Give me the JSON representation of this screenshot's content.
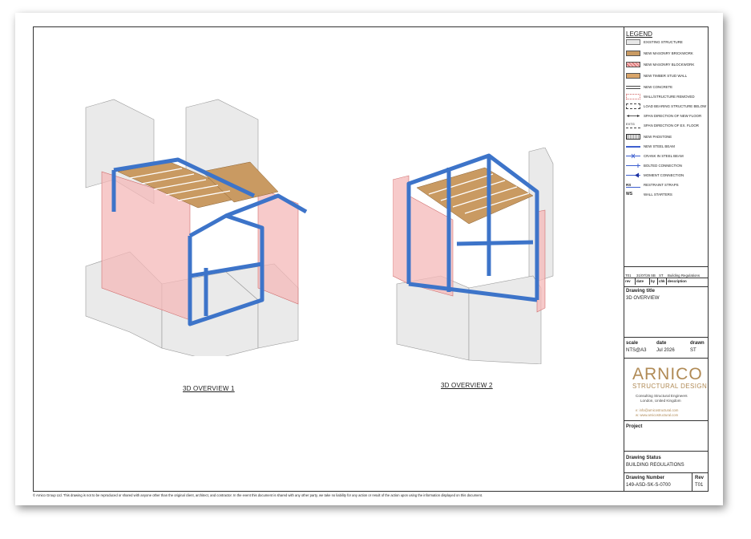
{
  "views": [
    {
      "label": "3D OVERVIEW 1"
    },
    {
      "label": "3D OVERVIEW 2"
    }
  ],
  "legend": {
    "title": "LEGEND",
    "items": [
      {
        "label": "EXISTING STRUCTURE"
      },
      {
        "label": "NEW MASONRY BRICKWORK"
      },
      {
        "label": "NEW MASONRY BLOCKWORK"
      },
      {
        "label": "NEW TIMBER STUD WALL"
      },
      {
        "label": "NEW CONCRETE"
      },
      {
        "label": "WALL/STRUCTURE REMOVED"
      },
      {
        "label": "LOAD BEARING STRUCTURE BELOW"
      },
      {
        "label": "SPAN DIRECTION OF NEW FLOOR"
      },
      {
        "label": "SPAN DIRECTION OF EX. FLOOR",
        "symbol_text": "EXTG"
      },
      {
        "label": "NEW PADSTONE"
      },
      {
        "label": "NEW STEEL BEAM"
      },
      {
        "label": "CRANK IN STEEL BEAM"
      },
      {
        "label": "BOLTED CONNECTION"
      },
      {
        "label": "MOMENT CONNECTION"
      },
      {
        "label": "RESTRAINT STRAPS",
        "symbol_text": "RS"
      },
      {
        "label": "WALL STARTERS",
        "symbol_text": "WS"
      }
    ]
  },
  "revision": {
    "entry": {
      "rev": "T01",
      "date": "31/07/26",
      "by": "SB",
      "chk": "ST",
      "description": "Building Regulations"
    },
    "headers": {
      "rev": "rev",
      "date": "date",
      "by": "by",
      "chk": "chk",
      "description": "description"
    }
  },
  "drawing_title": {
    "label": "Drawing title",
    "value": "3D OVERVIEW"
  },
  "meta": {
    "scale_label": "scale",
    "scale_value": "NTS@A3",
    "date_label": "date",
    "date_value": "Jul 2026",
    "drawn_label": "drawn",
    "drawn_value": "ST"
  },
  "company": {
    "name": "ARNICO",
    "tagline": "STRUCTURAL DESIGN",
    "line1": "Consulting Structural Engineers",
    "line2": "London, United Kingdom",
    "email": "e: info@arnicostructural.com",
    "web": "w: www.arnicostructural.com"
  },
  "project": {
    "label": "Project",
    "value": ""
  },
  "status": {
    "label": "Drawing Status",
    "value": "BUILDING REGULATIONS"
  },
  "number": {
    "label": "Drawing Number",
    "value": "149-ASD-SK-S-0700",
    "rev_label": "Rev",
    "rev_value": "T01"
  },
  "footer": "© Arnico Group Ltd. This drawing is not to be reproduced or shared with anyone other than the original client, architect, and contractor. In the event this document is shared with any other party, we take no liability for any action or result of the action upon using the information displayed on this document.",
  "colors": {
    "steel": "#3d74c9",
    "masonry": "#f4b8b8",
    "timber": "#c99a62",
    "existing": "#e4e4e4",
    "brand": "#b08a55"
  }
}
